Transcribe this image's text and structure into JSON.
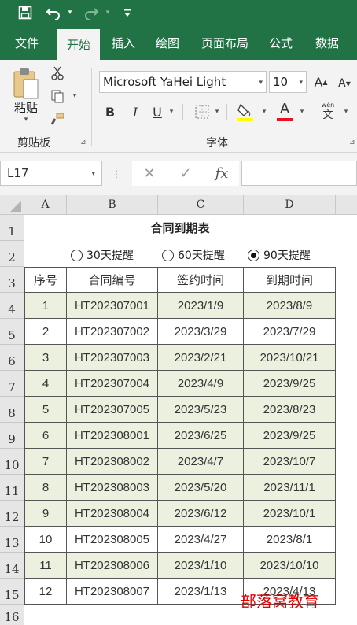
{
  "qat": {
    "save_icon": "save-icon",
    "undo_icon": "undo-icon",
    "redo_icon": "redo-icon",
    "customize_icon": "customize-icon"
  },
  "tabs": [
    {
      "label": "文件"
    },
    {
      "label": "开始",
      "active": true
    },
    {
      "label": "插入"
    },
    {
      "label": "绘图"
    },
    {
      "label": "页面布局"
    },
    {
      "label": "公式"
    },
    {
      "label": "数据"
    }
  ],
  "ribbon": {
    "paste_label": "粘贴",
    "clipboard_label": "剪贴板",
    "font_group_label": "字体",
    "font_name": "Microsoft YaHei Light",
    "font_size": "10",
    "bold": "B",
    "italic": "I",
    "underline": "U",
    "font_color_glyph": "A",
    "phonetic_top": "wén",
    "phonetic_bottom": "文",
    "grow_font": "A",
    "shrink_font": "A",
    "accent_color": "#217346",
    "font_color_bar": "#e81123",
    "highlight_bar": "#ffff00"
  },
  "formula_bar": {
    "name_box": "L17",
    "cancel": "✕",
    "enter": "✓",
    "fx": "fx",
    "value": ""
  },
  "sheet": {
    "columns": [
      "A",
      "B",
      "C",
      "D"
    ],
    "rows": [
      "1",
      "2",
      "3",
      "4",
      "5",
      "6",
      "7",
      "8",
      "9",
      "10",
      "11",
      "12",
      "13",
      "14",
      "15",
      "16"
    ],
    "title": "合同到期表",
    "radios": [
      {
        "label": "30天提醒",
        "checked": false
      },
      {
        "label": "60天提醒",
        "checked": false
      },
      {
        "label": "90天提醒",
        "checked": true
      }
    ],
    "headers": [
      "序号",
      "合同编号",
      "签约时间",
      "到期时间"
    ],
    "data": [
      {
        "no": "1",
        "code": "HT202307001",
        "sign": "2023/1/9",
        "due": "2023/8/9",
        "shade": true
      },
      {
        "no": "2",
        "code": "HT202307002",
        "sign": "2023/3/29",
        "due": "2023/7/29",
        "shade": false
      },
      {
        "no": "3",
        "code": "HT202307003",
        "sign": "2023/2/21",
        "due": "2023/10/21",
        "shade": true
      },
      {
        "no": "4",
        "code": "HT202307004",
        "sign": "2023/4/9",
        "due": "2023/9/25",
        "shade": true
      },
      {
        "no": "5",
        "code": "HT202307005",
        "sign": "2023/5/23",
        "due": "2023/8/23",
        "shade": true
      },
      {
        "no": "6",
        "code": "HT202308001",
        "sign": "2023/6/25",
        "due": "2023/9/25",
        "shade": true
      },
      {
        "no": "7",
        "code": "HT202308002",
        "sign": "2023/4/7",
        "due": "2023/10/7",
        "shade": true
      },
      {
        "no": "8",
        "code": "HT202308003",
        "sign": "2023/5/20",
        "due": "2023/11/1",
        "shade": true
      },
      {
        "no": "9",
        "code": "HT202308004",
        "sign": "2023/6/12",
        "due": "2023/10/1",
        "shade": true
      },
      {
        "no": "10",
        "code": "HT202308005",
        "sign": "2023/4/27",
        "due": "2023/8/1",
        "shade": false
      },
      {
        "no": "11",
        "code": "HT202308006",
        "sign": "2023/1/10",
        "due": "2023/10/10",
        "shade": true
      },
      {
        "no": "12",
        "code": "HT202308007",
        "sign": "2023/1/13",
        "due": "2023/4/13",
        "shade": false
      }
    ],
    "shade_color": "#ebf1de",
    "watermark": "部落窝教育"
  }
}
